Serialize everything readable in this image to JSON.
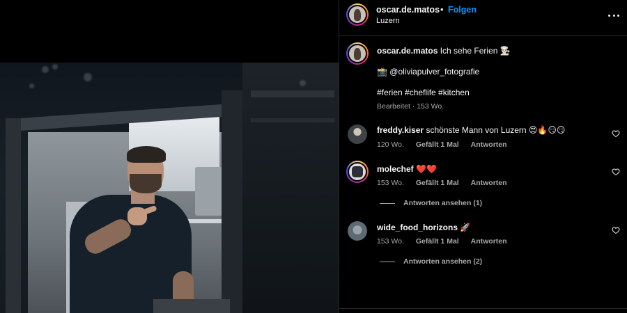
{
  "header": {
    "username": "oscar.de.matos",
    "separator": "•",
    "follow_label": "Folgen",
    "location": "Luzern",
    "more_icon": "more-horizontal-icon"
  },
  "caption": {
    "username": "oscar.de.matos",
    "text": "Ich sehe Ferien 👨🏻‍🍳",
    "credit": "📸 @oliviapulver_fotografie",
    "hashtags": "#ferien #cheflife #kitchen",
    "meta": "Bearbeitet · 153 Wo."
  },
  "comments": [
    {
      "username": "freddy.kiser",
      "text": "schönste Mann von Luzern 😍🔥😏😏",
      "age": "120 Wo.",
      "likes": "Gefällt 1 Mal",
      "reply_label": "Antworten",
      "view_replies": ""
    },
    {
      "username": "molechef",
      "text": "❤️❤️",
      "age": "153 Wo.",
      "likes": "Gefällt 1 Mal",
      "reply_label": "Antworten",
      "view_replies": "Antworten ansehen (1)"
    },
    {
      "username": "wide_food_horizons",
      "text": "🚀",
      "age": "153 Wo.",
      "likes": "Gefällt 1 Mal",
      "reply_label": "Antworten",
      "view_replies": "Antworten ansehen (2)"
    }
  ],
  "colors": {
    "accent_link": "#0095f6",
    "muted_text": "#a8a8a8",
    "background": "#000000"
  }
}
